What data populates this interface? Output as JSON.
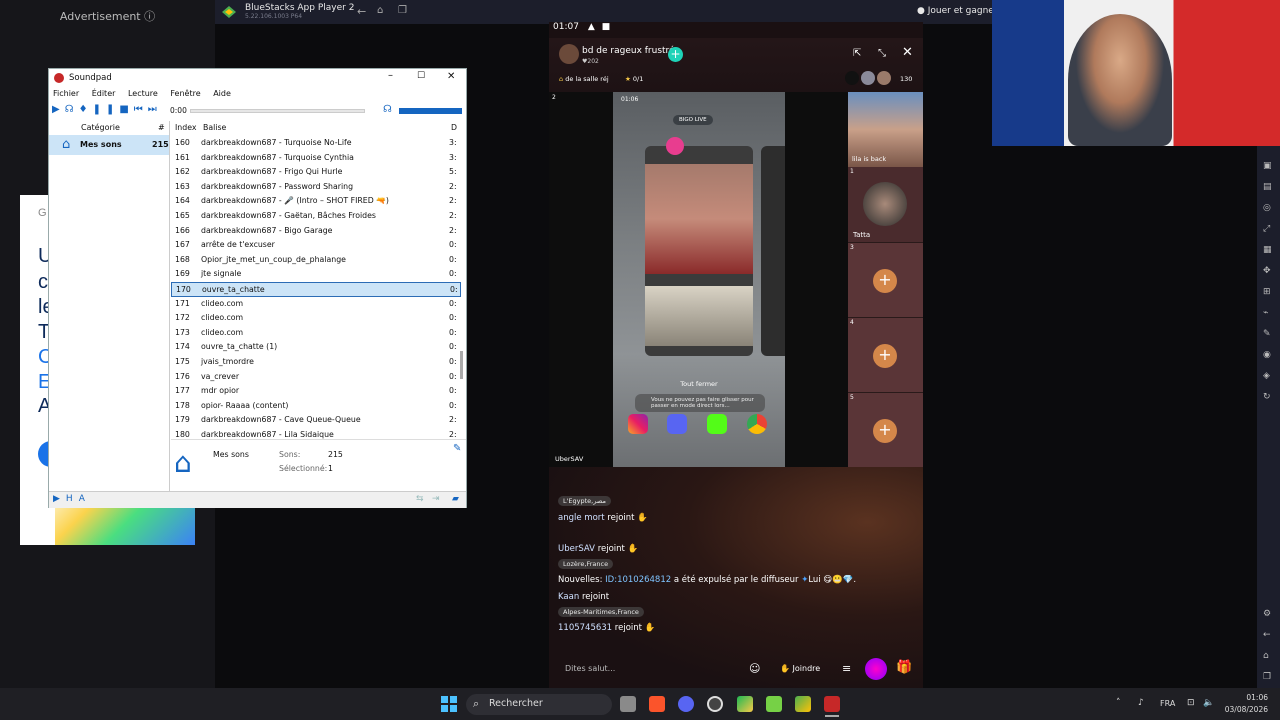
{
  "ad": {
    "label": "Advertisement",
    "letters": [
      "U",
      "c",
      "le",
      "T",
      "C",
      "E",
      "A"
    ]
  },
  "bluestacks": {
    "title": "BlueStacks App Player 2",
    "version": "5.22.106.1003  P64",
    "reward": "Jouer et gagner"
  },
  "phone": {
    "time": "01:07",
    "room_name": "bd de rageux frustrés",
    "host_meta": "202",
    "tag_left": "de la salle réj",
    "tag_count": "0/1",
    "viewer_count": "130",
    "mini_phone": {
      "time": "01:06",
      "app_label": "BIGO LIVE",
      "close_all": "Tout fermer",
      "hint": "Vous ne pouvez pas faire glisser pour passer en mode direct lors..."
    },
    "main_video_owner": "UberSAV",
    "seat_number_main": "2",
    "seats": [
      {
        "num": "",
        "name": "lila is back",
        "type": "video"
      },
      {
        "num": "1",
        "name": "Tatta",
        "type": "avatar"
      },
      {
        "num": "3",
        "name": "",
        "type": "empty"
      },
      {
        "num": "4",
        "name": "",
        "type": "empty"
      },
      {
        "num": "5",
        "name": "",
        "type": "empty"
      }
    ],
    "chat": [
      {
        "kind": "tag",
        "text": "L'Egypte,مصر"
      },
      {
        "kind": "join",
        "name": "angle mort",
        "action": "rejoint"
      },
      {
        "kind": "join",
        "name": "UberSAV",
        "action": "rejoint"
      },
      {
        "kind": "tag",
        "text": "Lozère,France"
      },
      {
        "kind": "notice",
        "prefix": "Nouvelles:",
        "id": "ID:1010264812",
        "text": "a été expulsé par le diffuseur",
        "suffix": "Lui"
      },
      {
        "kind": "join",
        "name": "Kaan",
        "action": "rejoint"
      },
      {
        "kind": "tag",
        "text": "Alpes-Maritimes,France"
      },
      {
        "kind": "join",
        "name": "1105745631",
        "action": "rejoint"
      }
    ],
    "input_placeholder": "Dites salut...",
    "join_label": "Joindre"
  },
  "soundpad": {
    "title": "Soundpad",
    "menu": [
      "Fichier",
      "Éditer",
      "Lecture",
      "Fenêtre",
      "Aide"
    ],
    "time": "0:00",
    "left_headers": {
      "category": "Catégorie",
      "count": "#"
    },
    "category": {
      "name": "Mes sons",
      "count": "215"
    },
    "table_headers": {
      "index": "Index",
      "tag": "Balise",
      "dur": "D"
    },
    "rows": [
      {
        "index": "160",
        "name": "darkbreakdown687 - Turquoise No-Life",
        "dur": "3:"
      },
      {
        "index": "161",
        "name": "darkbreakdown687 - Turquoise Cynthia",
        "dur": "3:"
      },
      {
        "index": "162",
        "name": "darkbreakdown687 - Frigo Qui Hurle",
        "dur": "5:"
      },
      {
        "index": "163",
        "name": "darkbreakdown687 - Password Sharing",
        "dur": "2:"
      },
      {
        "index": "164",
        "name": "darkbreakdown687 - 🎤 (Intro – SHOT FIRED 🔫)",
        "dur": "2:"
      },
      {
        "index": "165",
        "name": "darkbreakdown687 - Gaëtan, Bâches Froides",
        "dur": "2:"
      },
      {
        "index": "166",
        "name": "darkbreakdown687 - Bigo Garage",
        "dur": "2:"
      },
      {
        "index": "167",
        "name": "arrête de t'excuser",
        "dur": "0:"
      },
      {
        "index": "168",
        "name": "Opior_jte_met_un_coup_de_phalange",
        "dur": "0:"
      },
      {
        "index": "169",
        "name": "jte signale",
        "dur": "0:"
      },
      {
        "index": "170",
        "name": "ouvre_ta_chatte",
        "dur": "0:"
      },
      {
        "index": "171",
        "name": "clideo.com",
        "dur": "0:"
      },
      {
        "index": "172",
        "name": "clideo.com",
        "dur": "0:"
      },
      {
        "index": "173",
        "name": "clideo.com",
        "dur": "0:"
      },
      {
        "index": "174",
        "name": "ouvre_ta_chatte (1)",
        "dur": "0:"
      },
      {
        "index": "175",
        "name": "jvais_tmordre",
        "dur": "0:"
      },
      {
        "index": "176",
        "name": "va_crever",
        "dur": "0:"
      },
      {
        "index": "177",
        "name": "mdr opior",
        "dur": "0:"
      },
      {
        "index": "178",
        "name": "opior- Raaaa (content)",
        "dur": "0:"
      },
      {
        "index": "179",
        "name": "darkbreakdown687 - Cave Queue-Queue",
        "dur": "2:"
      },
      {
        "index": "180",
        "name": "darkbreakdown687 - Lila Sidaique",
        "dur": "2:"
      }
    ],
    "selected_row": 10,
    "info": {
      "name": "Mes sons",
      "sounds_label": "Sons:",
      "sounds_value": "215",
      "selected_label": "Sélectionné:",
      "selected_value": "1"
    }
  },
  "taskbar": {
    "search_label": "Rechercher",
    "lang": "FRA",
    "time": "01:06",
    "date": "03/08/2026"
  }
}
